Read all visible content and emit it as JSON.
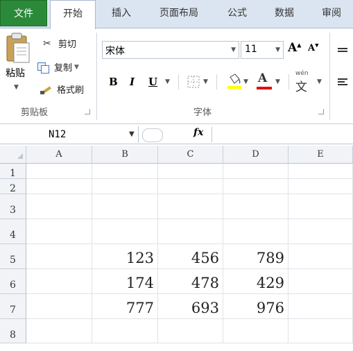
{
  "tabs": [
    "文件",
    "开始",
    "插入",
    "页面布局",
    "公式",
    "数据",
    "审阅"
  ],
  "clipboard": {
    "paste": "粘贴",
    "cut": "剪切",
    "copy": "复制",
    "format_painter": "格式刷",
    "group_label": "剪贴板"
  },
  "font": {
    "family": "宋体",
    "size": "11",
    "bold": "B",
    "italic": "I",
    "underline": "U",
    "font_color_letter": "A",
    "wen_top": "wén",
    "wen_char": "文",
    "group_label": "字体"
  },
  "formula_bar": {
    "name_box": "N12",
    "fx": "fx",
    "formula": ""
  },
  "sheet": {
    "columns": [
      "A",
      "B",
      "C",
      "D",
      "E"
    ],
    "rows": [
      "1",
      "2",
      "3",
      "4",
      "5",
      "6",
      "7",
      "8"
    ],
    "cells": {
      "B5": "123",
      "C5": "456",
      "D5": "789",
      "B6": "174",
      "C6": "478",
      "D6": "429",
      "B7": "777",
      "C7": "693",
      "D7": "976"
    }
  },
  "colors": {
    "file_tab": "#2a8a3a",
    "ribbon_bg": "#dbe5f1",
    "font_color_bar": "#e01010",
    "fill_color_bar": "#ffff00"
  }
}
